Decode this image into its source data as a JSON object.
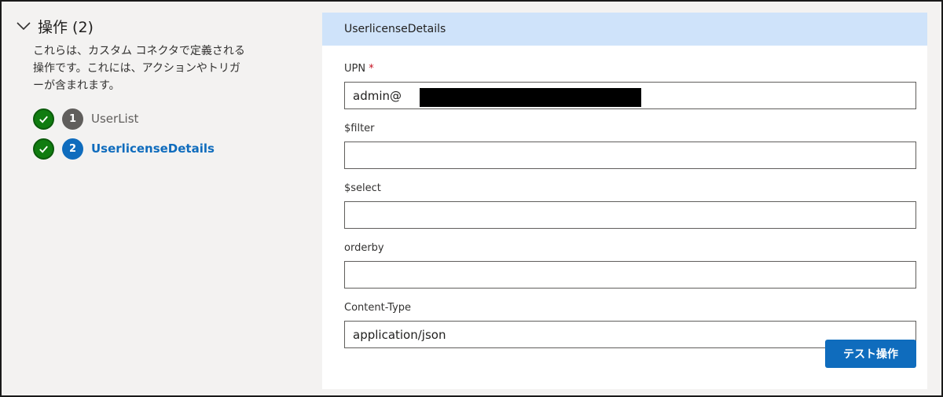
{
  "section": {
    "title": "操作 (2)",
    "description": "これらは、カスタム コネクタで定義される操作です。これには、アクションやトリガーが含まれます。"
  },
  "steps": [
    {
      "number": "1",
      "label": "UserList",
      "state": "completed",
      "active": false
    },
    {
      "number": "2",
      "label": "UserlicenseDetails",
      "state": "completed",
      "active": true
    }
  ],
  "panel": {
    "title": "UserlicenseDetails",
    "fields": [
      {
        "label": "UPN",
        "required_mark": "*",
        "value": "admin@"
      },
      {
        "label": "$filter",
        "value": ""
      },
      {
        "label": "$select",
        "value": ""
      },
      {
        "label": "orderby",
        "value": ""
      },
      {
        "label": "Content-Type",
        "value": "application/json"
      }
    ],
    "test_button": "テスト操作"
  },
  "colors": {
    "accent": "#0f6cbd",
    "success": "#107c10",
    "header_bg": "#cfe3fa"
  }
}
